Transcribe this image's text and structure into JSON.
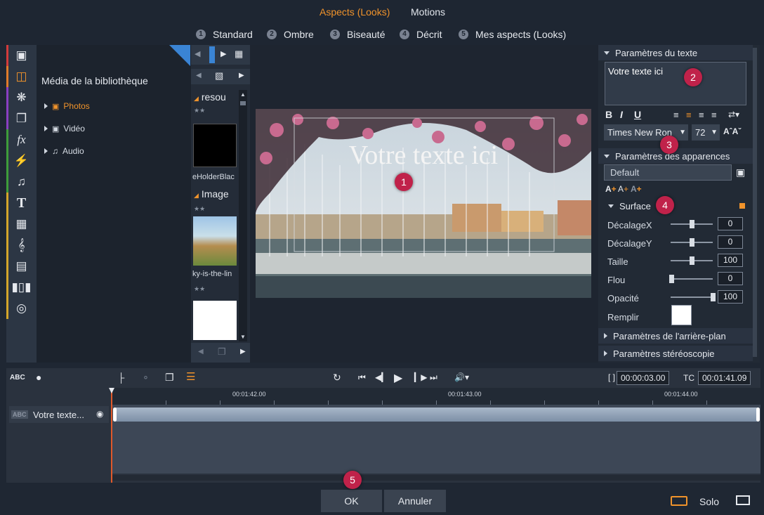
{
  "tabs": {
    "aspects": "Aspects (Looks)",
    "motions": "Motions"
  },
  "presets": [
    {
      "num": "1",
      "label": "Standard"
    },
    {
      "num": "2",
      "label": "Ombre"
    },
    {
      "num": "3",
      "label": "Biseauté"
    },
    {
      "num": "4",
      "label": "Décrit"
    },
    {
      "num": "5",
      "label": "Mes aspects (Looks)"
    }
  ],
  "library": {
    "title": "Média de la bibliothèque",
    "items": [
      "Photos",
      "Vidéo",
      "Audio"
    ]
  },
  "thumbs": {
    "group1": "resou",
    "label1": "eHolderBlac",
    "group2": "Image",
    "label2": "ky-is-the-lin"
  },
  "preview": {
    "overlay_text": "Votre texte ici"
  },
  "text_params": {
    "header": "Paramètres du texte",
    "content": "Votre texte ici",
    "bold": "B",
    "italic": "I",
    "underline": "U",
    "font": "Times New Ron",
    "size": "72"
  },
  "appearance": {
    "header": "Paramètres des apparences",
    "preset": "Default",
    "surface": "Surface",
    "rows": [
      {
        "label": "DécalageX",
        "value": "0"
      },
      {
        "label": "DécalageY",
        "value": "0"
      },
      {
        "label": "Taille",
        "value": "100"
      },
      {
        "label": "Flou",
        "value": "0"
      },
      {
        "label": "Opacité",
        "value": "100"
      }
    ],
    "fill_label": "Remplir"
  },
  "sections": {
    "background": "Paramètres de l'arrière-plan",
    "stereo": "Paramètres stéréoscopie"
  },
  "timeline": {
    "abc": "ABC",
    "timecode_label": "[ ]",
    "duration": "00:00:03.00",
    "tc_label": "TC",
    "timecode": "00:01:41.09",
    "ruler": [
      "00:01:42.00",
      "00:01:43.00",
      "00:01:44.00"
    ],
    "track_name": "Votre texte..."
  },
  "buttons": {
    "ok": "OK",
    "cancel": "Annuler",
    "solo": "Solo"
  },
  "badges": [
    "1",
    "2",
    "3",
    "4",
    "5"
  ],
  "colors": {
    "accent": "#f0932b",
    "badge": "#c0224a"
  }
}
